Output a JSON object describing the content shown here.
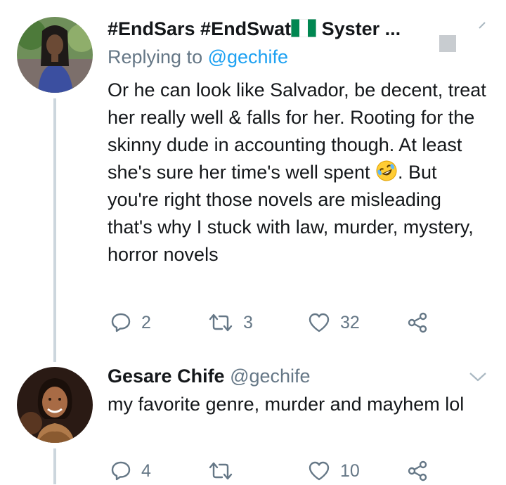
{
  "tweets": [
    {
      "display_name_prefix": "#EndSars #EndSwat",
      "display_name_suffix": " Syster ...",
      "flag_icon": "nigeria-flag-icon",
      "reply_prefix": "Replying to ",
      "reply_mention": "@gechife",
      "text_part1": "Or he can look like Salvador, be decent, treat her really well & falls for her. Rooting for the skinny dude in accounting though. At least she's sure her time's well spent ",
      "emoji": "rolling-on-floor-laughing-icon",
      "text_part2": ". But you're right those novels are misleading that's why I stuck with law, murder, mystery, horror novels",
      "replies": "2",
      "retweets": "3",
      "likes": "32"
    },
    {
      "display_name": "Gesare Chife",
      "handle": "@gechife",
      "text": "my favorite genre, murder and mayhem lol",
      "replies": "4",
      "retweets": "",
      "likes": "10"
    }
  ],
  "colors": {
    "text": "#14171a",
    "secondary": "#657786",
    "link": "#1da1f2",
    "thread_line": "#ccd6dd"
  }
}
